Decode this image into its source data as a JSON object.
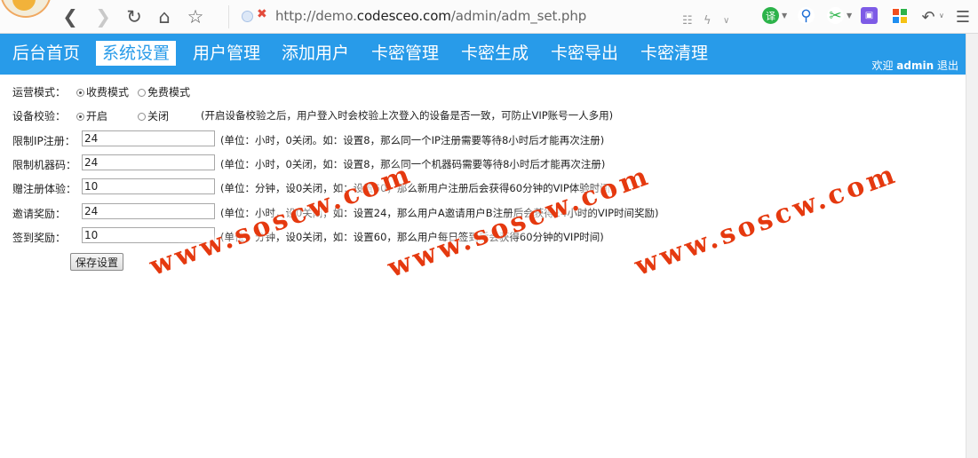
{
  "browser": {
    "url_prefix": "http://demo.",
    "url_domain": "codesceo.com",
    "url_path": "/admin/adm_set.php",
    "back_icon": "chevron-left-icon",
    "forward_icon": "chevron-right-icon",
    "reload_icon": "reload-icon",
    "home_icon": "home-icon",
    "star_icon": "star-icon",
    "translate_label": "译"
  },
  "nav": {
    "tabs": [
      {
        "label": "后台首页"
      },
      {
        "label": "系统设置"
      },
      {
        "label": "用户管理"
      },
      {
        "label": "添加用户"
      },
      {
        "label": "卡密管理"
      },
      {
        "label": "卡密生成"
      },
      {
        "label": "卡密导出"
      },
      {
        "label": "卡密清理"
      }
    ],
    "active_index": 1,
    "welcome_prefix": "欢迎",
    "user": "admin",
    "logout": "退出"
  },
  "form": {
    "mode": {
      "label": "运营模式：",
      "options": [
        "收费模式",
        "免费模式"
      ],
      "selected": "收费模式"
    },
    "device": {
      "label": "设备校验：",
      "options": [
        "开启",
        "关闭"
      ],
      "selected": "开启",
      "hint": "(开启设备校验之后，用户登入时会校验上次登入的设备是否一致，可防止VIP账号一人多用)"
    },
    "fields": [
      {
        "label": "限制IP注册：",
        "value": "24",
        "hint": "(单位：小时，0关闭。如：设置8，那么同一个IP注册需要等待8小时后才能再次注册)"
      },
      {
        "label": "限制机器码：",
        "value": "24",
        "hint": "(单位：小时，0关闭，如：设置8，那么同一个机器码需要等待8小时后才能再次注册)"
      },
      {
        "label": "赠注册体验：",
        "value": "10",
        "hint": "(单位：分钟，设0关闭，如：设置60，那么新用户注册后会获得60分钟的VIP体验时间)"
      },
      {
        "label": "邀请奖励：",
        "value": "24",
        "hint": "(单位：小时，设0关闭，如：设置24，那么用户A邀请用户B注册后会获得24小时的VIP时间奖励)"
      },
      {
        "label": "签到奖励：",
        "value": "10",
        "hint": "(单位：分钟，设0关闭，如：设置60，那么用户每日签到后会获得60分钟的VIP时间)"
      }
    ],
    "save_label": "保存设置"
  },
  "watermark": "www.soscw.com",
  "colors": {
    "header_bg": "#289be9",
    "watermark": "#e5390f"
  }
}
